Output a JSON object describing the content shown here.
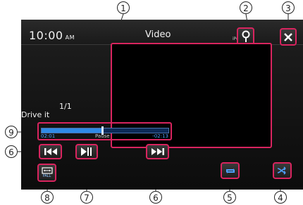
{
  "status_bar": {
    "time": "10:00",
    "ampm": "AM",
    "title": "Video",
    "source": "iPod"
  },
  "track": {
    "index": "1/1",
    "name": "Drive it"
  },
  "progress": {
    "elapsed": "02:01",
    "remaining": "-02:13",
    "state": "Pause",
    "fraction": 0.48
  },
  "buttons": {
    "repeat_sub_label": "PALL"
  },
  "callouts": {
    "c1": "1",
    "c2": "2",
    "c3": "3",
    "c4": "4",
    "c5": "5",
    "c6a": "6",
    "c6b": "6",
    "c7": "7",
    "c8": "8",
    "c9": "9"
  },
  "colors": {
    "highlight": "#d9245f",
    "progress_fill": "#2f8ae6",
    "progress_track": "#0d2a57"
  },
  "icons": {
    "search": "magnifier-icon",
    "close": "close-icon",
    "prev": "skip-previous-icon",
    "play_pause": "play-pause-icon",
    "next": "skip-next-icon",
    "repeat": "repeat-icon",
    "shuffle": "shuffle-icon",
    "screen_mode": "screen-mode-icon"
  }
}
